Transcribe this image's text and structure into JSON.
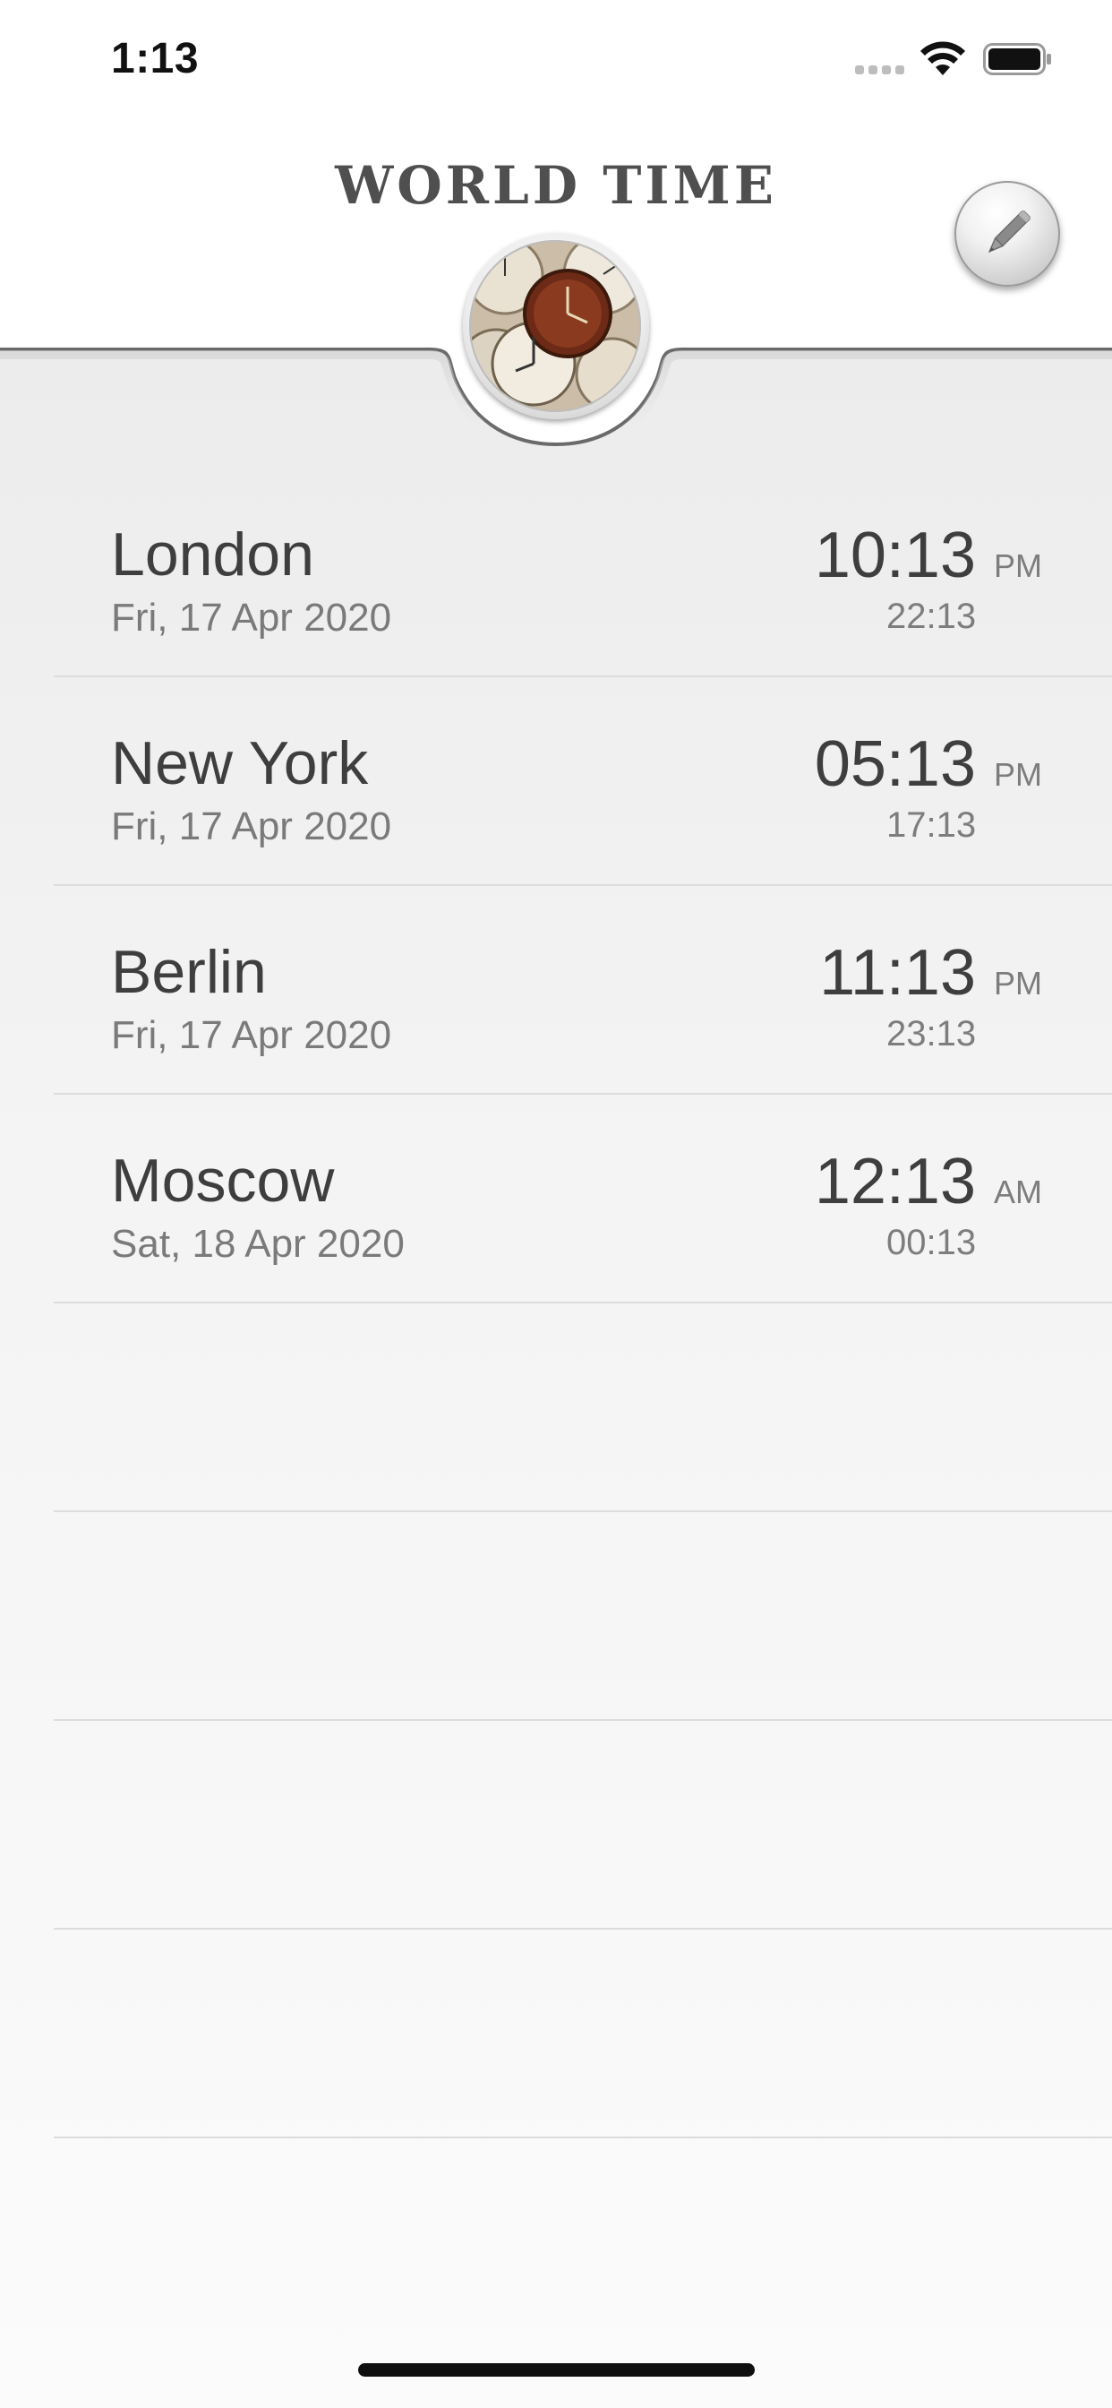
{
  "status_bar": {
    "time": "1:13",
    "icons": [
      "cellular-signal-icon",
      "wifi-icon",
      "battery-icon"
    ]
  },
  "header": {
    "title": "WORLD TIME",
    "edit_icon": "pencil-icon",
    "logo": "clocks-logo-icon"
  },
  "colors": {
    "background_top": "#ffffff",
    "panel": "#f1f1f1",
    "divider": "#dcdcdc",
    "text_primary": "#3e3e3e",
    "text_secondary": "#7a7a7a"
  },
  "cities": [
    {
      "name": "London",
      "date": "Fri, 17 Apr 2020",
      "time": "10:13",
      "ampm": "PM",
      "time24": "22:13"
    },
    {
      "name": "New York",
      "date": "Fri, 17 Apr 2020",
      "time": "05:13",
      "ampm": "PM",
      "time24": "17:13"
    },
    {
      "name": "Berlin",
      "date": "Fri, 17 Apr 2020",
      "time": "11:13",
      "ampm": "PM",
      "time24": "23:13"
    },
    {
      "name": "Moscow",
      "date": "Sat, 18 Apr 2020",
      "time": "12:13",
      "ampm": "AM",
      "time24": "00:13"
    }
  ]
}
